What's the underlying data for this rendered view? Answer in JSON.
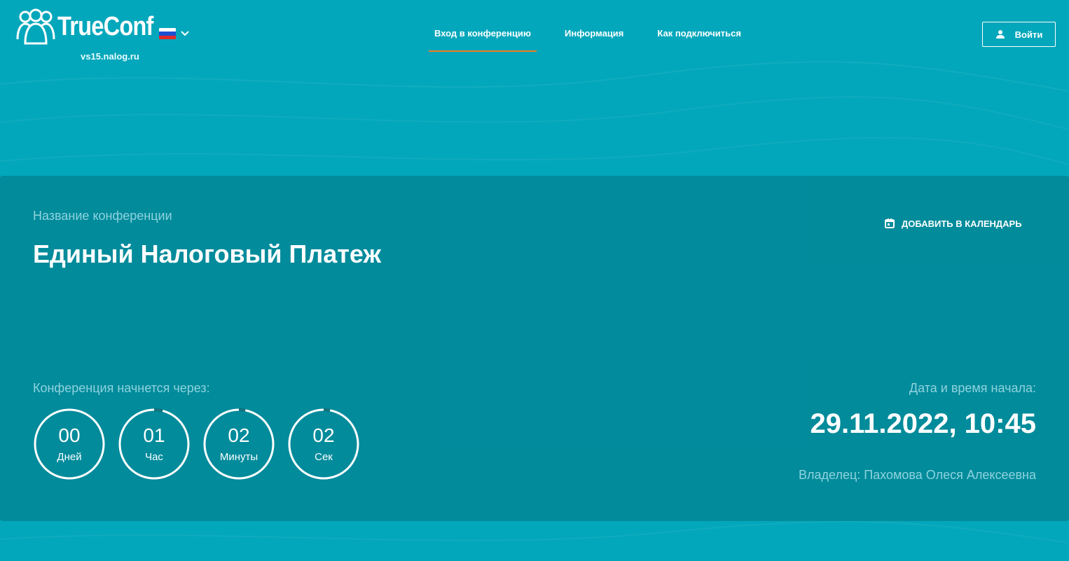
{
  "header": {
    "logo_text": "TrueConf",
    "domain": "vs15.nalog.ru",
    "language": "ru",
    "nav": [
      {
        "label": "Вход в конференцию",
        "active": true
      },
      {
        "label": "Информация",
        "active": false
      },
      {
        "label": "Как подключиться",
        "active": false
      }
    ],
    "login_label": "Войти"
  },
  "conference": {
    "name_label": "Название конференции",
    "title": "Единый Налоговый Платеж",
    "add_calendar_label": "ДОБАВИТЬ В КАЛЕНДАРЬ",
    "starts_in_label": "Конференция начнется через:",
    "countdown": [
      {
        "value": "00",
        "unit": "Дней",
        "progress": 0.0
      },
      {
        "value": "01",
        "unit": "Час",
        "progress": 0.04
      },
      {
        "value": "02",
        "unit": "Минуты",
        "progress": 0.03
      },
      {
        "value": "02",
        "unit": "Сек",
        "progress": 0.03
      }
    ],
    "start_label": "Дата и время начала:",
    "start_value": "29.11.2022, 10:45",
    "owner": "Владелец: Пахомова Олеся Алексеевна"
  },
  "colors": {
    "background": "#03a7bb",
    "card": "#018d9b",
    "accent": "#ef7d1a",
    "muted_text": "#8fd3de"
  }
}
